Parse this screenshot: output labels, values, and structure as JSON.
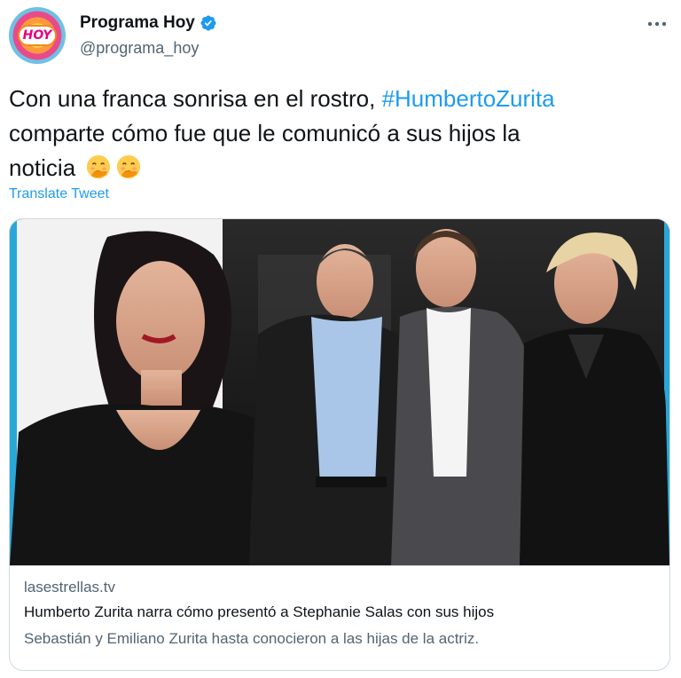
{
  "author": {
    "display_name": "Programa Hoy",
    "handle": "@programa_hoy",
    "avatar_logo_text": "HOY"
  },
  "tweet": {
    "text_line1_prefix": "Con una franca sonrisa en el rostro, ",
    "hashtag": "#HumbertoZurita",
    "text_line2": "comparte cómo fue que le comunicó a sus hijos la",
    "text_line3": "noticia",
    "translate_label": "Translate Tweet"
  },
  "card": {
    "domain": "lasestrellas.tv",
    "title": "Humberto Zurita narra cómo presentó a Stephanie Salas con sus hijos",
    "description": "Sebastián y Emiliano Zurita hasta conocieron a las hijas de la actriz."
  },
  "colors": {
    "accent": "#1d9bf0",
    "text_primary": "#0f1419",
    "text_secondary": "#536471",
    "border": "#cfd9de"
  },
  "icons": {
    "verified": "verified-badge-icon",
    "more": "more-horizontal-icon",
    "emoji": "face-with-hand-over-mouth-emoji"
  }
}
